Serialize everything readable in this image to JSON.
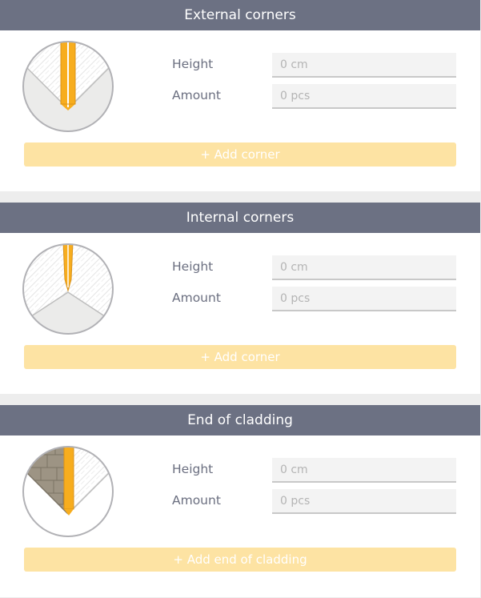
{
  "sections": [
    {
      "title": "External corners",
      "height_label": "Height",
      "amount_label": "Amount",
      "height_placeholder": "0 cm",
      "amount_placeholder": "0 pcs",
      "button_label": "+ Add corner",
      "icon": "external-corner-illustration"
    },
    {
      "title": "Internal corners",
      "height_label": "Height",
      "amount_label": "Amount",
      "height_placeholder": "0 cm",
      "amount_placeholder": "0 pcs",
      "button_label": "+ Add corner",
      "icon": "internal-corner-illustration"
    },
    {
      "title": "End of cladding",
      "height_label": "Height",
      "amount_label": "Amount",
      "height_placeholder": "0 cm",
      "amount_placeholder": "0 pcs",
      "button_label": "+ Add end of cladding",
      "icon": "end-of-cladding-illustration"
    }
  ],
  "colors": {
    "header_bg": "#6c7183",
    "accent_orange": "#f7ad1e",
    "button_bg": "#fde3a3",
    "field_bg": "#f3f3f3",
    "label_text": "#6b6f80"
  }
}
